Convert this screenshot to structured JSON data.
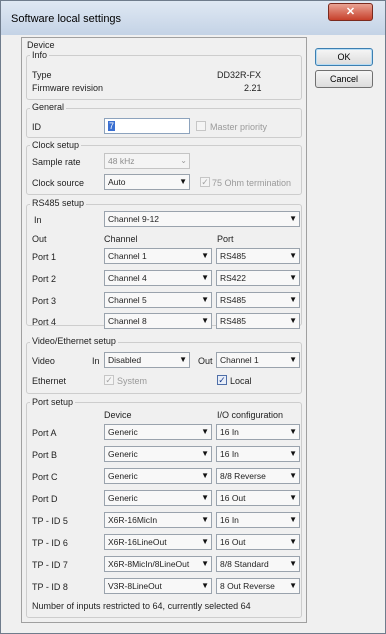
{
  "window": {
    "title": "Software local settings",
    "close_label": "✕"
  },
  "buttons": {
    "ok": "OK",
    "cancel": "Cancel"
  },
  "device": {
    "legend": "Device",
    "info_legend": "Info",
    "type_label": "Type",
    "type_value": "DD32R-FX",
    "fw_label": "Firmware revision",
    "fw_value": "2.21"
  },
  "general": {
    "legend": "General",
    "id_label": "ID",
    "id_value": "7",
    "master_label": "Master priority"
  },
  "clock": {
    "legend": "Clock setup",
    "rate_label": "Sample rate",
    "rate_value": "48 kHz",
    "source_label": "Clock source",
    "source_value": "Auto",
    "term_label": "75 Ohm termination"
  },
  "rs485": {
    "legend": "RS485 setup",
    "in_label": "In",
    "in_value": "Channel 9-12",
    "out_label": "Out",
    "channel_header": "Channel",
    "port_header": "Port",
    "rows": [
      {
        "label": "Port 1",
        "channel": "Channel 1",
        "port": "RS485"
      },
      {
        "label": "Port 2",
        "channel": "Channel 4",
        "port": "RS422"
      },
      {
        "label": "Port 3",
        "channel": "Channel 5",
        "port": "RS485"
      },
      {
        "label": "Port 4",
        "channel": "Channel 8",
        "port": "RS485"
      }
    ]
  },
  "video": {
    "legend": "Video/Ethernet setup",
    "video_label": "Video",
    "in_label": "In",
    "in_value": "Disabled",
    "out_label": "Out",
    "out_value": "Channel 1",
    "ethernet_label": "Ethernet",
    "system_label": "System",
    "local_label": "Local"
  },
  "portsetup": {
    "legend": "Port setup",
    "device_header": "Device",
    "io_header": "I/O configuration",
    "rows": [
      {
        "label": "Port A",
        "device": "Generic",
        "io": "16 In"
      },
      {
        "label": "Port B",
        "device": "Generic",
        "io": "16 In"
      },
      {
        "label": "Port C",
        "device": "Generic",
        "io": "8/8 Reverse"
      },
      {
        "label": "Port D",
        "device": "Generic",
        "io": "16 Out"
      },
      {
        "label": "TP - ID 5",
        "device": "X6R-16MicIn",
        "io": "16 In"
      },
      {
        "label": "TP - ID 6",
        "device": "X6R-16LineOut",
        "io": "16 Out"
      },
      {
        "label": "TP - ID 7",
        "device": "X6R-8MicIn/8LineOut",
        "io": "8/8 Standard"
      },
      {
        "label": "TP - ID 8",
        "device": "V3R-8LineOut",
        "io": "8 Out Reverse"
      }
    ],
    "footer": "Number of inputs restricted to 64, currently selected 64"
  },
  "icons": {
    "dropdown": "chevron-down-icon",
    "check": "checkmark-icon"
  }
}
